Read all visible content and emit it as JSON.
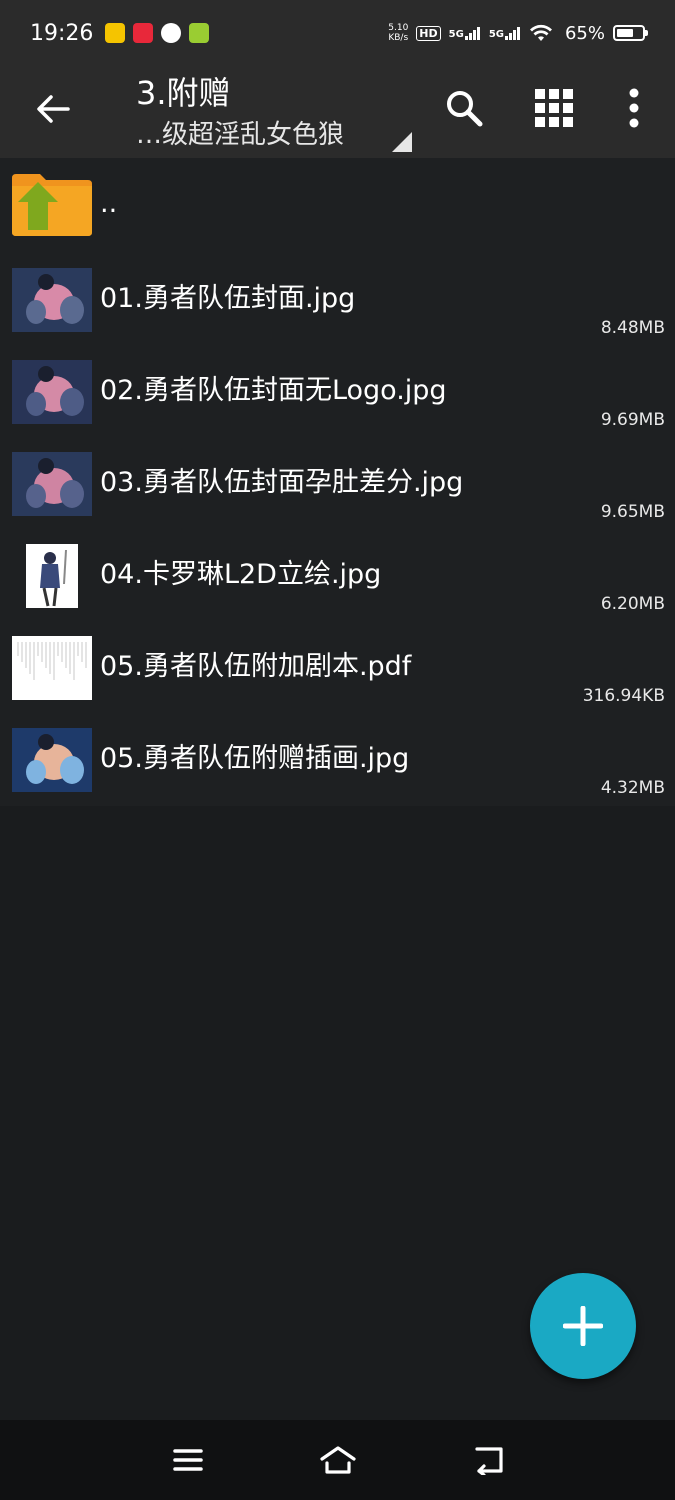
{
  "status_bar": {
    "time": "19:26",
    "net_speed_value": "5.10",
    "net_speed_unit": "KB/s",
    "hd_label": "HD",
    "signal1": "5G",
    "signal2": "5G",
    "battery_percent": "65%",
    "battery_level": 0.65
  },
  "toolbar": {
    "title": "3.附赠",
    "subtitle": "…级超淫乱女色狼"
  },
  "parent_dir_label": "..",
  "files": [
    {
      "name": "01.勇者队伍封面.jpg",
      "size": "8.48MB",
      "thumb": "image"
    },
    {
      "name": "02.勇者队伍封面无Logo.jpg",
      "size": "9.69MB",
      "thumb": "image"
    },
    {
      "name": "03.勇者队伍封面孕肚差分.jpg",
      "size": "9.65MB",
      "thumb": "image"
    },
    {
      "name": "04.卡罗琳L2D立绘.jpg",
      "size": "6.20MB",
      "thumb": "portrait"
    },
    {
      "name": "05.勇者队伍附加剧本.pdf",
      "size": "316.94KB",
      "thumb": "document"
    },
    {
      "name": "05.勇者队伍附赠插画.jpg",
      "size": "4.32MB",
      "thumb": "image"
    }
  ],
  "colors": {
    "accent": "#1aa9c4",
    "bar": "#2b2b2b",
    "folder": "#f0941e",
    "up_arrow": "#7fa81e"
  }
}
